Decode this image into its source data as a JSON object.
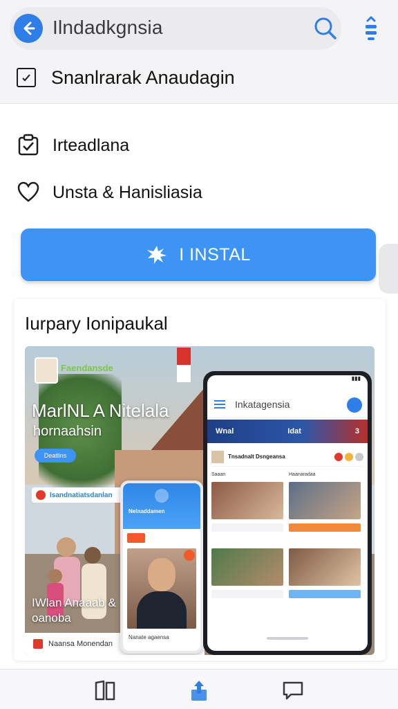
{
  "header": {
    "title": "Ilndadkgnsia",
    "subtitle": "Snanlrarak Anaudagin",
    "icons": {
      "back": "back-arrow-icon",
      "search": "search-icon",
      "more": "share-more-icon",
      "subtitle": "document-check-icon"
    }
  },
  "menu": {
    "items": [
      {
        "label": "Irteadlana",
        "icon": "clipboard-check-icon"
      },
      {
        "label": "Unsta & Hanisliasia",
        "icon": "heart-icon"
      }
    ]
  },
  "install_button": {
    "label": "I INSTAL",
    "icon": "sparkle-icon"
  },
  "preview_card": {
    "title": "Iurpary Ionipaukal",
    "hero": {
      "brand": "Faendansde",
      "headline": "MarlNL A Nitelala",
      "subheadline": "hornaahsin",
      "chip": "Deatlins",
      "banner": "Isandnatiatsdanlan",
      "bottom_line1": "IWlan Anaaab &",
      "bottom_line2": "oanoba",
      "footer": "Naansa Monendan"
    },
    "phone_big": {
      "app_name": "Inkatagensia",
      "nav_left": "Wnal",
      "nav_right": "Idat",
      "nav_count": "3",
      "user_line": "Tnsadnalt Dsngeansa",
      "feed": [
        {
          "caption": "Saaan"
        },
        {
          "caption": "Haanaradaa"
        },
        {
          "caption": ""
        },
        {
          "caption": ""
        }
      ]
    },
    "phone_small": {
      "header_label": "Nelnaddamen",
      "caption": "Nanate agaensa"
    }
  },
  "colors": {
    "accent": "#2f7ee8",
    "install_bg": "#3d94f5",
    "alert": "#e0392b"
  },
  "bottom_nav": {
    "items": [
      {
        "icon": "book-icon"
      },
      {
        "icon": "share-upload-icon"
      },
      {
        "icon": "chat-bubble-icon"
      }
    ]
  }
}
